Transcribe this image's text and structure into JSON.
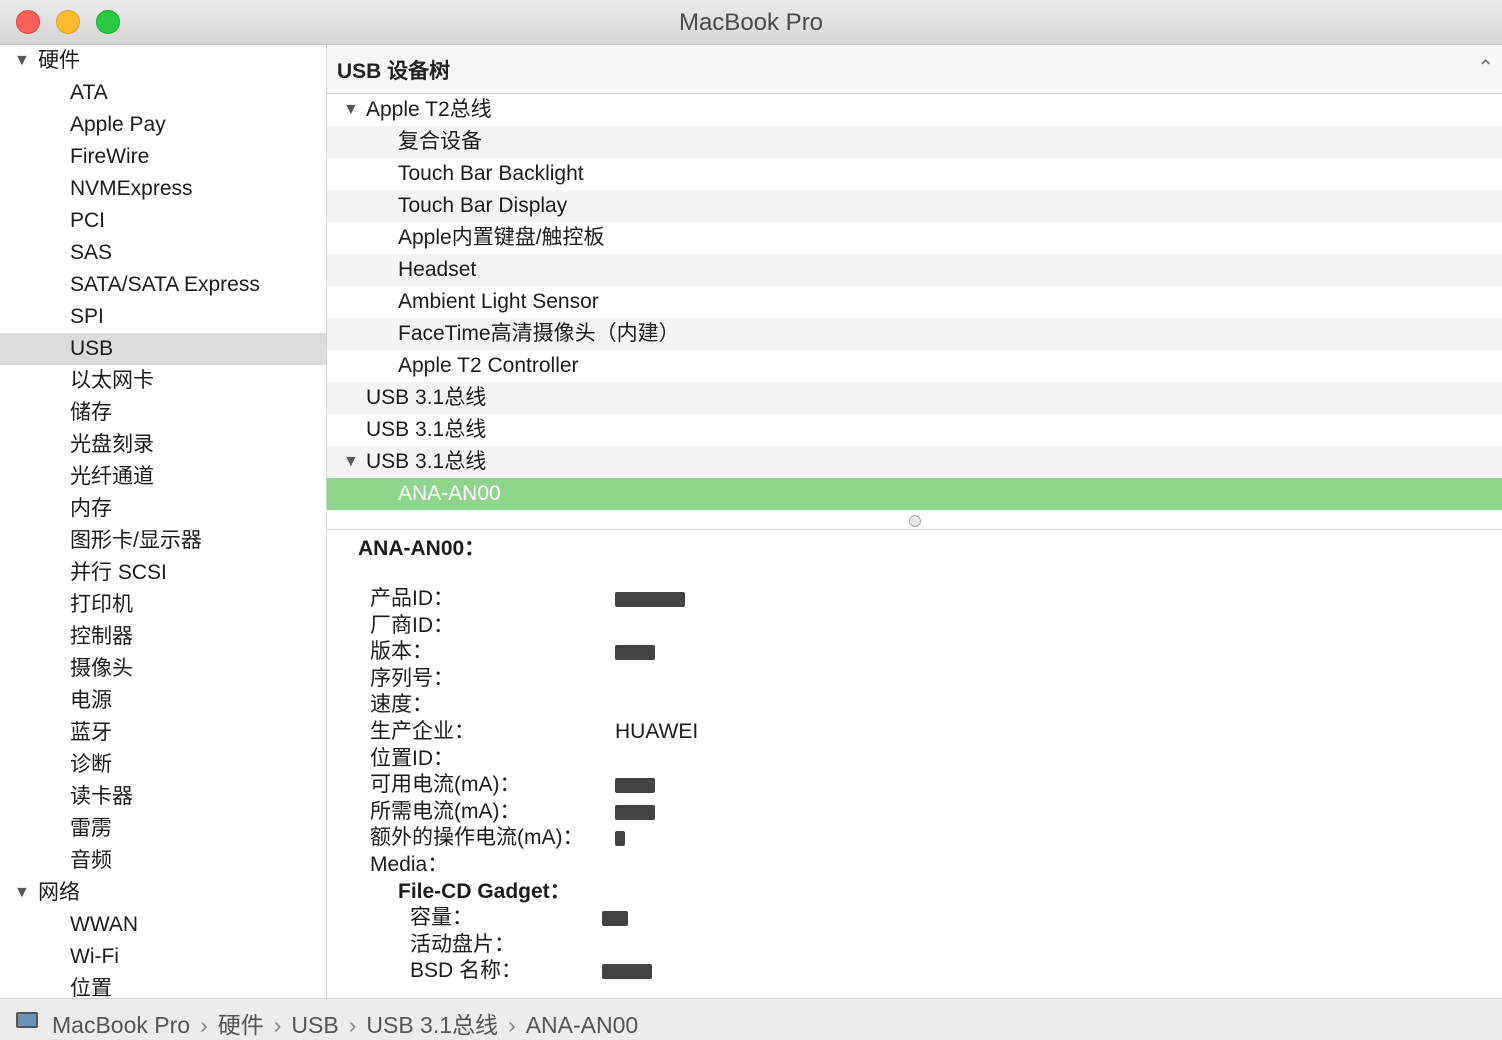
{
  "window": {
    "title": "MacBook Pro"
  },
  "sidebar": {
    "groups": [
      {
        "label": "硬件",
        "items": [
          "ATA",
          "Apple Pay",
          "FireWire",
          "NVMExpress",
          "PCI",
          "SAS",
          "SATA/SATA Express",
          "SPI",
          "USB",
          "以太网卡",
          "储存",
          "光盘刻录",
          "光纤通道",
          "内存",
          "图形卡/显示器",
          "并行 SCSI",
          "打印机",
          "控制器",
          "摄像头",
          "电源",
          "蓝牙",
          "诊断",
          "读卡器",
          "雷雳",
          "音频"
        ]
      },
      {
        "label": "网络",
        "items": [
          "WWAN",
          "Wi-Fi",
          "位置"
        ]
      }
    ],
    "selected": "USB"
  },
  "tree": {
    "header": "USB 设备树",
    "rows": [
      {
        "label": "Apple T2总线",
        "level": 0,
        "expanded": true
      },
      {
        "label": "复合设备",
        "level": 1
      },
      {
        "label": "Touch Bar Backlight",
        "level": 1
      },
      {
        "label": "Touch Bar Display",
        "level": 1
      },
      {
        "label": "Apple内置键盘/触控板",
        "level": 1
      },
      {
        "label": "Headset",
        "level": 1
      },
      {
        "label": "Ambient Light Sensor",
        "level": 1
      },
      {
        "label": "FaceTime高清摄像头（内建）",
        "level": 1
      },
      {
        "label": "Apple T2 Controller",
        "level": 1
      },
      {
        "label": "USB 3.1总线",
        "level": 0
      },
      {
        "label": "USB 3.1总线",
        "level": 0
      },
      {
        "label": "USB 3.1总线",
        "level": 0,
        "expanded": true
      },
      {
        "label": "ANA-AN00",
        "level": 1,
        "selected": true
      }
    ]
  },
  "detail": {
    "title": "ANA-AN00：",
    "properties": [
      {
        "key": "产品ID：",
        "value": ""
      },
      {
        "key": "厂商ID：",
        "value": ""
      },
      {
        "key": "版本：",
        "value": ""
      },
      {
        "key": "序列号：",
        "value": ""
      },
      {
        "key": "速度：",
        "value": ""
      },
      {
        "key": "生产企业：",
        "value": "HUAWEI"
      },
      {
        "key": "位置ID：",
        "value": ""
      },
      {
        "key": "可用电流(mA)：",
        "value": ""
      },
      {
        "key": "所需电流(mA)：",
        "value": ""
      },
      {
        "key": "额外的操作电流(mA)：",
        "value": ""
      },
      {
        "key": "Media：",
        "value": ""
      }
    ],
    "media": {
      "name": "File-CD Gadget：",
      "properties": [
        {
          "key": "容量：",
          "value": ""
        },
        {
          "key": "活动盘片：",
          "value": ""
        },
        {
          "key": "BSD 名称：",
          "value": ""
        }
      ]
    }
  },
  "statusbar": {
    "breadcrumbs": [
      "MacBook Pro",
      "硬件",
      "USB",
      "USB 3.1总线",
      "ANA-AN00"
    ],
    "separator": "›"
  }
}
